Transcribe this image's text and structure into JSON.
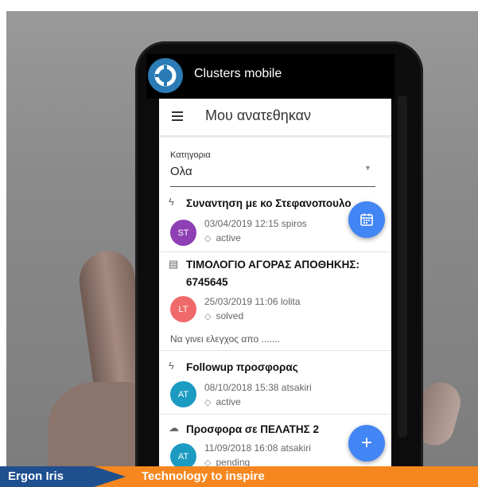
{
  "app": {
    "name": "Clusters mobile"
  },
  "header": {
    "title": "Μου ανατεθηκαν"
  },
  "category": {
    "label": "Κατηγορια",
    "value": "Ολα"
  },
  "items": [
    {
      "icon": "lightning-icon",
      "title": "Συναντηση με κο Στεφανοπουλο",
      "initials": "ST",
      "avatar_color": "#8e3fb3",
      "datetime": "03/04/2019 12:15",
      "user": "spiros",
      "status": "active",
      "note": ""
    },
    {
      "icon": "document-icon",
      "title": "ΤΙΜΟΛΟΓΙΟ ΑΓΟΡΑΣ ΑΠΟΘΗΚΗΣ: 6745645",
      "initials": "LT",
      "avatar_color": "#f06a6a",
      "datetime": "25/03/2019 11:06",
      "user": "lolita",
      "status": "solved",
      "note": "Να γινει ελεγχος απο ......."
    },
    {
      "icon": "lightning-icon",
      "title": "Followup προσφορας",
      "initials": "AT",
      "avatar_color": "#1b9ac2",
      "datetime": "08/10/2018 15:38",
      "user": "atsakiri",
      "status": "active",
      "note": ""
    },
    {
      "icon": "cloud-upload-icon",
      "title": "Προσφορα σε ΠΕΛΑΤΗΣ 2",
      "initials": "AT",
      "avatar_color": "#1b9ac2",
      "datetime": "11/09/2018 16:08",
      "user": "atsakiri",
      "status": "pending",
      "note": ""
    }
  ],
  "footer": {
    "brand": "Ergon Iris",
    "tagline": "Technology to inspire"
  },
  "colors": {
    "accent": "#4285f4",
    "footer_orange": "#f6871f",
    "footer_blue": "#1e4f8f"
  }
}
